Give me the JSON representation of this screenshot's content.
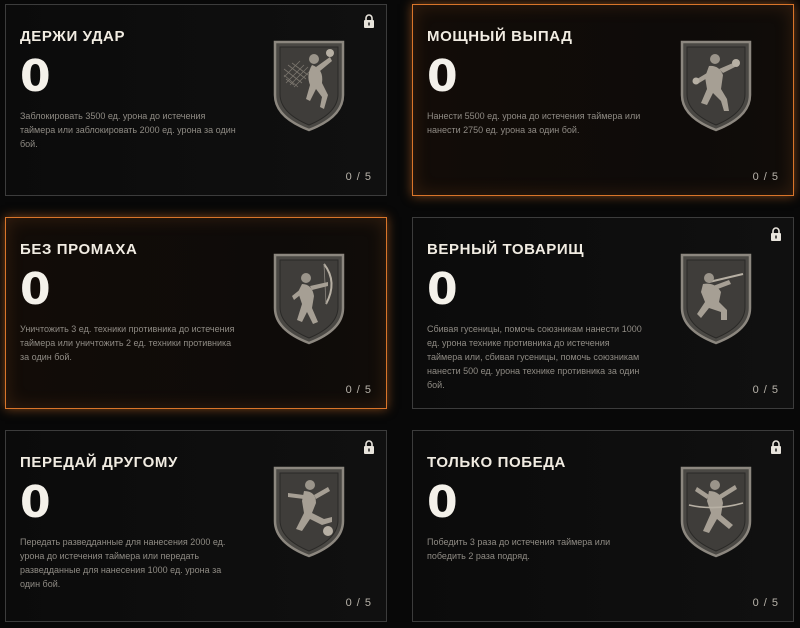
{
  "colors": {
    "accent": "#d9752a",
    "badge_fill": "#4a4844",
    "badge_border": "#8c877f"
  },
  "cards": [
    {
      "title": "ДЕРЖИ УДАР",
      "score": "0",
      "description": "Заблокировать 3500 ед. урона до истечения таймера или заблокировать 2000 ед. урона за один бой.",
      "progress": "0 / 5",
      "locked": true,
      "active": false,
      "icon": "volleyball-player-badge-icon"
    },
    {
      "title": "МОЩНЫЙ ВЫПАД",
      "score": "0",
      "description": "Нанести 5500 ед. урона до истечения таймера или нанести 2750 ед. урона за один бой.",
      "progress": "0 / 5",
      "locked": false,
      "active": true,
      "icon": "boxer-badge-icon"
    },
    {
      "title": "БЕЗ ПРОМАХА",
      "score": "0",
      "description": "Уничтожить 3 ед. техники противника до истечения таймера или уничтожить 2 ед. техники противника за один бой.",
      "progress": "0 / 5",
      "locked": false,
      "active": true,
      "icon": "archer-badge-icon"
    },
    {
      "title": "ВЕРНЫЙ ТОВАРИЩ",
      "score": "0",
      "description": "Сбивая гусеницы, помочь союзникам нанести 1000 ед. урона технике противника до истечения таймера или, сбивая гусеницы, помочь союзникам нанести 500 ед. урона технике противника за один бой.",
      "progress": "0 / 5",
      "locked": true,
      "active": false,
      "icon": "kneeling-shooter-badge-icon"
    },
    {
      "title": "ПЕРЕДАЙ ДРУГОМУ",
      "score": "0",
      "description": "Передать разведданные для нанесения 2000 ед. урона до истечения таймера или передать разведданные для нанесения 1000 ед. урона за один бой.",
      "progress": "0 / 5",
      "locked": true,
      "active": false,
      "icon": "football-player-badge-icon"
    },
    {
      "title": "ТОЛЬКО ПОБЕДА",
      "score": "0",
      "description": "Победить 3 раза до истечения таймера или победить 2 раза подряд.",
      "progress": "0 / 5",
      "locked": true,
      "active": false,
      "icon": "runner-finish-badge-icon"
    }
  ]
}
